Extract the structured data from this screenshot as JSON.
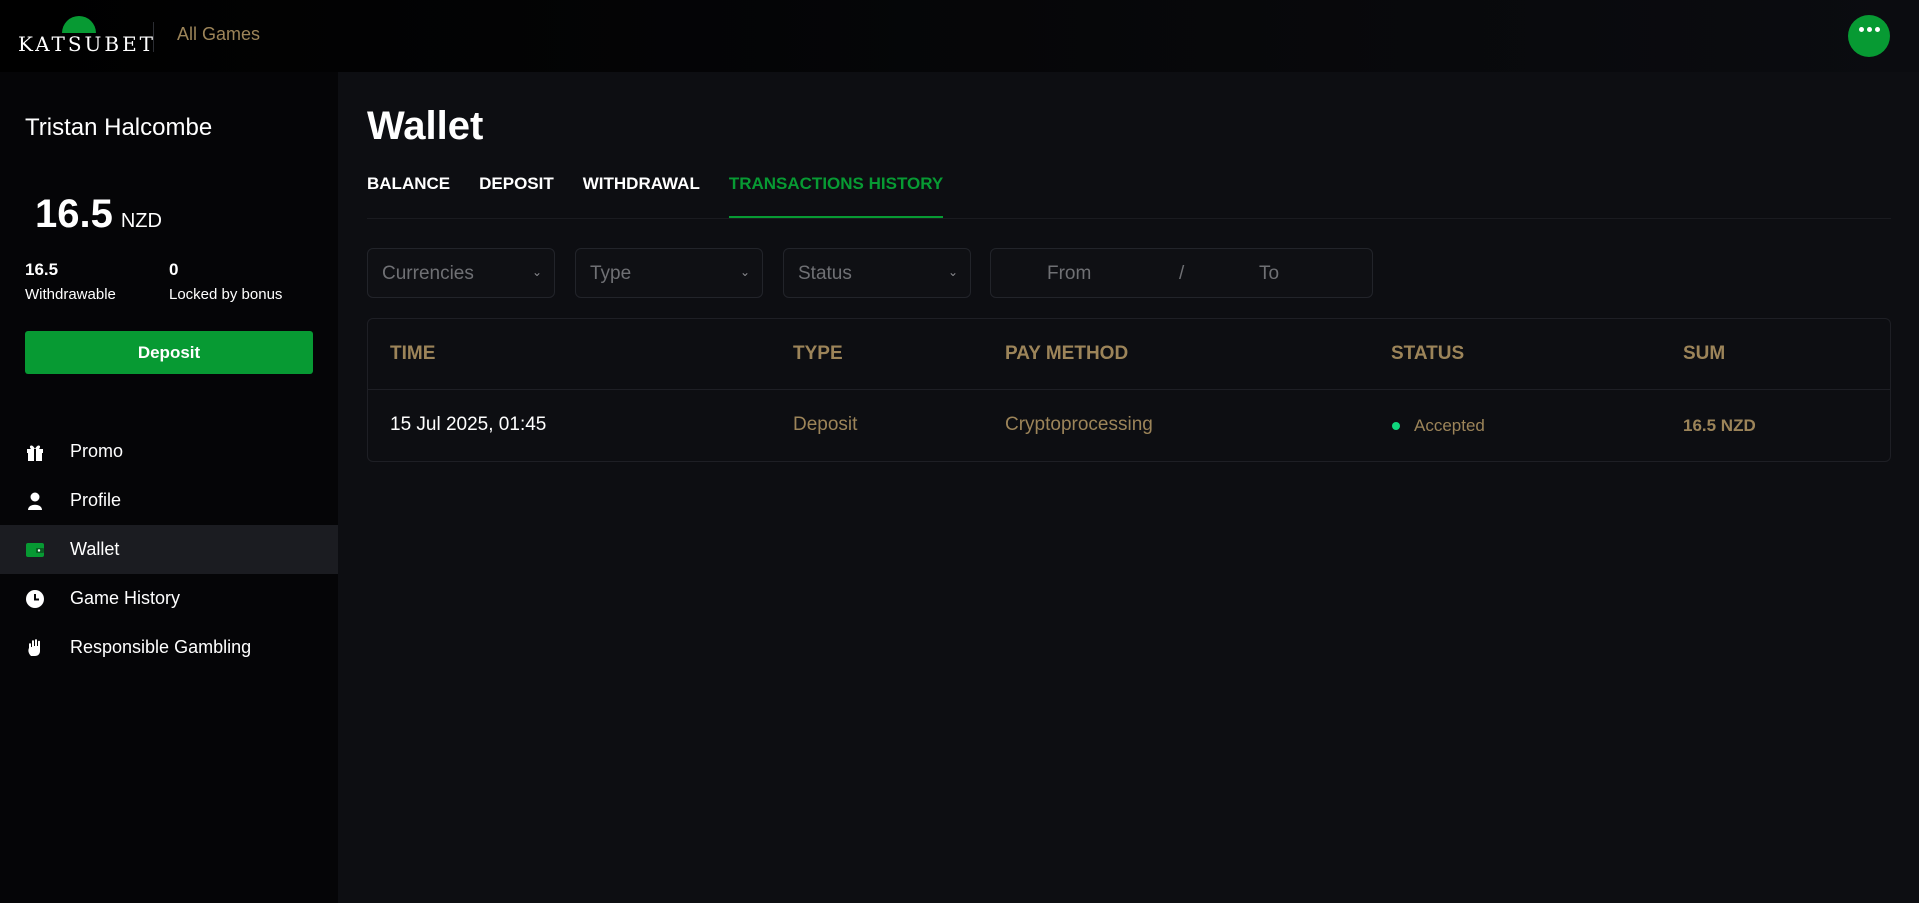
{
  "header": {
    "logo_text": "KATSUBET",
    "all_games": "All Games"
  },
  "sidebar": {
    "user_name": "Tristan Halcombe",
    "balance": {
      "amount": "16.5",
      "currency": "NZD"
    },
    "withdrawable": {
      "value": "16.5",
      "label": "Withdrawable"
    },
    "locked": {
      "value": "0",
      "label": "Locked by bonus"
    },
    "deposit_label": "Deposit",
    "nav": [
      {
        "label": "Promo",
        "icon": "gift-icon"
      },
      {
        "label": "Profile",
        "icon": "user-icon"
      },
      {
        "label": "Wallet",
        "icon": "wallet-icon",
        "active": true
      },
      {
        "label": "Game History",
        "icon": "clock-icon"
      },
      {
        "label": "Responsible Gambling",
        "icon": "hand-icon"
      }
    ]
  },
  "main": {
    "title": "Wallet",
    "tabs": [
      {
        "label": "BALANCE"
      },
      {
        "label": "DEPOSIT"
      },
      {
        "label": "WITHDRAWAL"
      },
      {
        "label": "TRANSACTIONS HISTORY",
        "active": true
      }
    ],
    "filters": {
      "currencies": "Currencies",
      "type": "Type",
      "status": "Status",
      "from": "From",
      "separator": "/",
      "to": "To"
    },
    "table": {
      "columns": [
        "TIME",
        "TYPE",
        "PAY METHOD",
        "STATUS",
        "SUM"
      ],
      "rows": [
        {
          "time": "15 Jul 2025, 01:45",
          "type": "Deposit",
          "pay_method": "Cryptoprocessing",
          "status": "Accepted",
          "sum": "16.5 NZD"
        }
      ]
    }
  },
  "colors": {
    "accent": "#079a33",
    "gold": "#9c8459",
    "status_accepted": "#0fd67d"
  }
}
